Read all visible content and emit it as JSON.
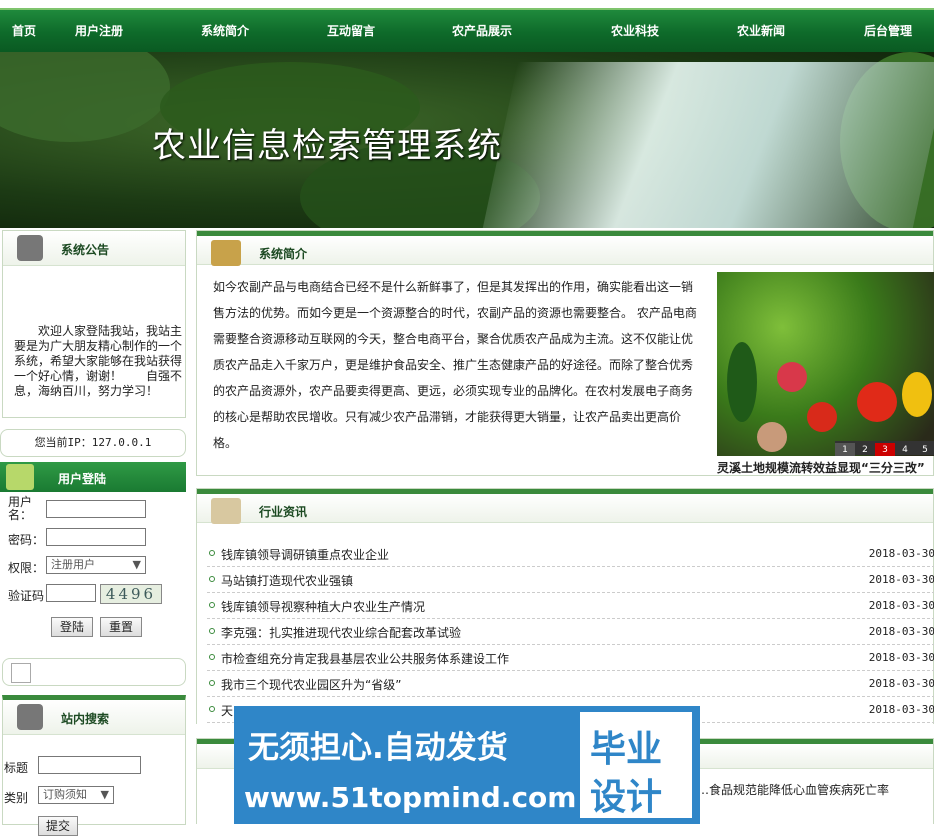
{
  "nav": [
    "首页",
    "用户注册",
    "系统简介",
    "互动留言",
    "农产品展示",
    "农业科技",
    "农业新闻",
    "后台管理"
  ],
  "banner": {
    "title": "农业信息检索管理系统"
  },
  "notice": {
    "heading": "系统公告",
    "text": "欢迎人家登陆我站，我站主要是为广大朋友精心制作的一个系统，希望大家能够在我站获得一个好心情，谢谢！　　自强不息，海纳百川，努力学习！"
  },
  "ip": {
    "text": "您当前IP：127.0.0.1"
  },
  "login": {
    "heading": "用户登陆",
    "username_label": "用户名：",
    "password_label": "密码：",
    "role_label": "权限：",
    "role_value": "注册用户",
    "captcha_label": "验证码",
    "captcha_value": "4496",
    "login_btn": "登陆",
    "reset_btn": "重置"
  },
  "search": {
    "heading": "站内搜索",
    "title_label": "标题",
    "category_label": "类别",
    "category_value": "订购须知",
    "submit": "提交"
  },
  "intro": {
    "heading": "系统简介",
    "text": "如今农副产品与电商结合已经不是什么新鲜事了，但是其发挥出的作用，确实能看出这一销售方法的优势。而如今更是一个资源整合的时代，农副产品的资源也需要整合。 农产品电商需要整合资源移动互联网的今天，整合电商平台，聚合优质农产品成为主流。这不仅能让优质农产品走入千家万户，更是维护食品安全、推广生态健康产品的好途径。而除了整合优秀的农产品资源外，农产品要卖得更高、更远，必须实现专业的品牌化。在农村发展电子商务的核心是帮助农民增收。只有减少农产品滞销，才能获得更大销量，让农产品卖出更高价格。",
    "caption": "灵溪土地规模流转效益显现“三分三改”",
    "pager": [
      "1",
      "2",
      "3",
      "4",
      "5"
    ]
  },
  "news": {
    "heading": "行业资讯",
    "items": [
      {
        "title": "钱库镇领导调研镇重点农业企业",
        "date": "2018-03-30"
      },
      {
        "title": "马站镇打造现代农业强镇",
        "date": "2018-03-30"
      },
      {
        "title": "钱库镇领导视察种植大户农业生产情况",
        "date": "2018-03-30"
      },
      {
        "title": "李克强：扎实推进现代农业综合配套改革试验",
        "date": "2018-03-30"
      },
      {
        "title": "市检查组充分肯定我县基层农业公共服务体系建设工作",
        "date": "2018-03-30"
      },
      {
        "title": "我市三个现代农业园区升为“省级”",
        "date": "2018-03-30"
      },
      {
        "title": "天…",
        "date": "2018-03-30"
      }
    ]
  },
  "bottom_news": {
    "text": "…食品规范能降低心血管疾病死亡率"
  },
  "watermark": {
    "line1": "无须担心.自动发货",
    "line2": "www.51topmind.com",
    "badge1": "毕业",
    "badge2": "设计"
  }
}
